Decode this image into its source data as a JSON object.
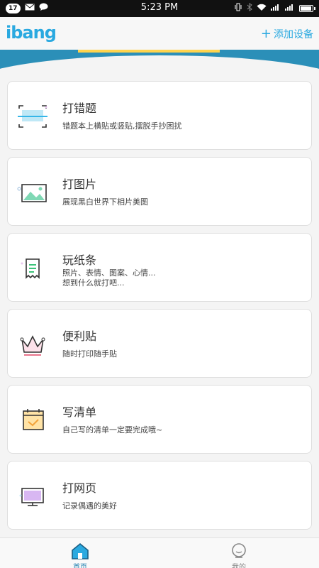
{
  "status": {
    "notif_count": "17",
    "time": "5:23 PM"
  },
  "header": {
    "logo": "ibang",
    "add_device": "添加设备"
  },
  "cards": [
    {
      "title": "打错题",
      "desc": "错题本上横贴或竖贴,摆脱手抄困扰"
    },
    {
      "title": "打图片",
      "desc": "展现黑白世界下相片美图"
    },
    {
      "title": "玩纸条",
      "desc1": "照片、表情、图案、心情...",
      "desc2": "想到什么就打吧..."
    },
    {
      "title": "便利贴",
      "desc": "随时打印随手贴"
    },
    {
      "title": "写清单",
      "desc": "自己写的清单一定要完成哦~"
    },
    {
      "title": "打网页",
      "desc": "记录偶遇的美好"
    }
  ],
  "tabs": {
    "home": "首页",
    "mine": "我的"
  },
  "colors": {
    "accent": "#2aa9e0",
    "tab_active": "#1e7fb0"
  }
}
